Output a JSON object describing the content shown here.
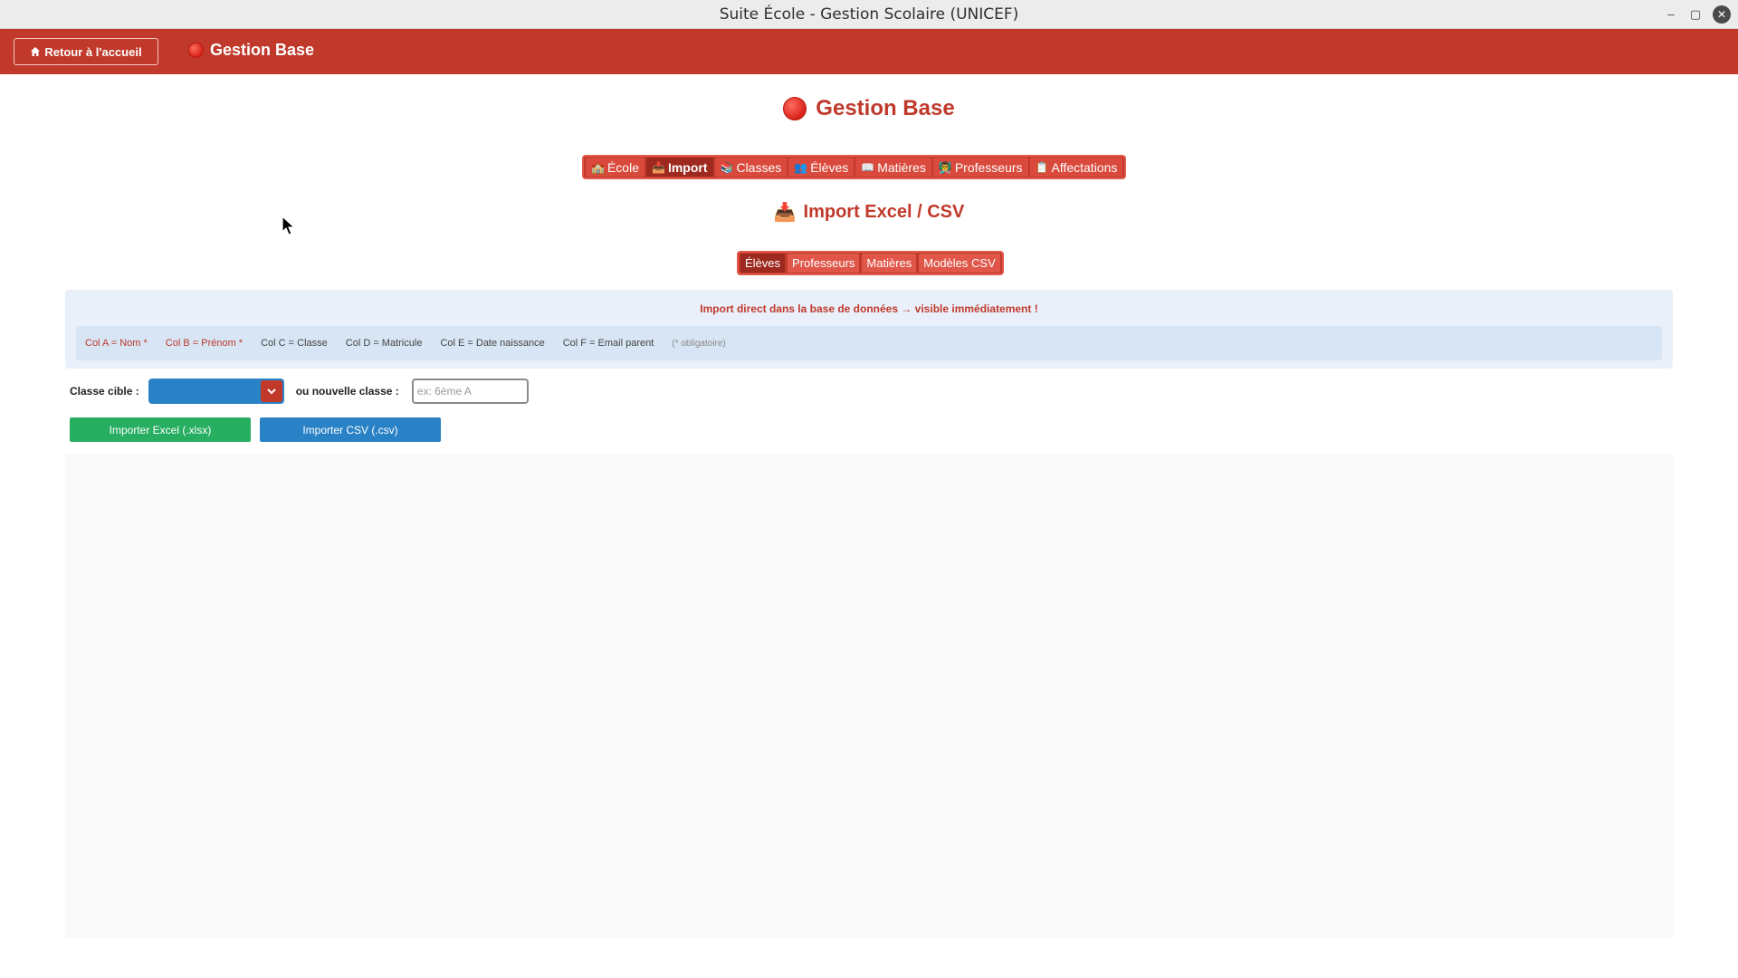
{
  "window": {
    "title": "Suite École - Gestion Scolaire (UNICEF)",
    "controls": {
      "minimize": "–",
      "maximize": "▢",
      "close": "✕"
    }
  },
  "header": {
    "back_icon": "home-icon",
    "back_label": "Retour à l'accueil",
    "app_title": "Gestion Base"
  },
  "page": {
    "heading": "Gestion Base",
    "accent_color": "#c0392b"
  },
  "main_tabs": [
    {
      "icon": "🏫",
      "label": "École"
    },
    {
      "icon": "📥",
      "label": "Import",
      "active": true
    },
    {
      "icon": "📚",
      "label": "Classes"
    },
    {
      "icon": "👥",
      "label": "Élèves"
    },
    {
      "icon": "📖",
      "label": "Matières"
    },
    {
      "icon": "👨‍🏫",
      "label": "Professeurs"
    },
    {
      "icon": "📋",
      "label": "Affectations"
    }
  ],
  "section": {
    "icon": "📥",
    "heading": "Import Excel / CSV"
  },
  "sub_tabs": [
    {
      "label": "Élèves",
      "active": true
    },
    {
      "label": "Professeurs"
    },
    {
      "label": "Matières"
    },
    {
      "label": "Modèles CSV"
    }
  ],
  "info": {
    "notice": "Import direct dans la base de données → visible immédiatement !",
    "columns": [
      {
        "label": "Col A = Nom *",
        "required": true
      },
      {
        "label": "Col B = Prénom *",
        "required": true
      },
      {
        "label": "Col C = Classe",
        "required": false
      },
      {
        "label": "Col D = Matricule",
        "required": false
      },
      {
        "label": "Col E = Date naissance",
        "required": false
      },
      {
        "label": "Col F = Email parent",
        "required": false
      }
    ],
    "note": "(* obligatoire)"
  },
  "form": {
    "target_class_label": "Classe cible :",
    "target_class_value": "",
    "new_class_label": "ou nouvelle classe :",
    "new_class_placeholder": "ex: 6ème A",
    "new_class_value": ""
  },
  "buttons": {
    "import_excel": "Importer Excel (.xlsx)",
    "import_csv": "Importer CSV (.csv)"
  },
  "colors": {
    "primary_red": "#c0392b",
    "excel_green": "#27ae60",
    "csv_blue": "#2a82c6"
  }
}
